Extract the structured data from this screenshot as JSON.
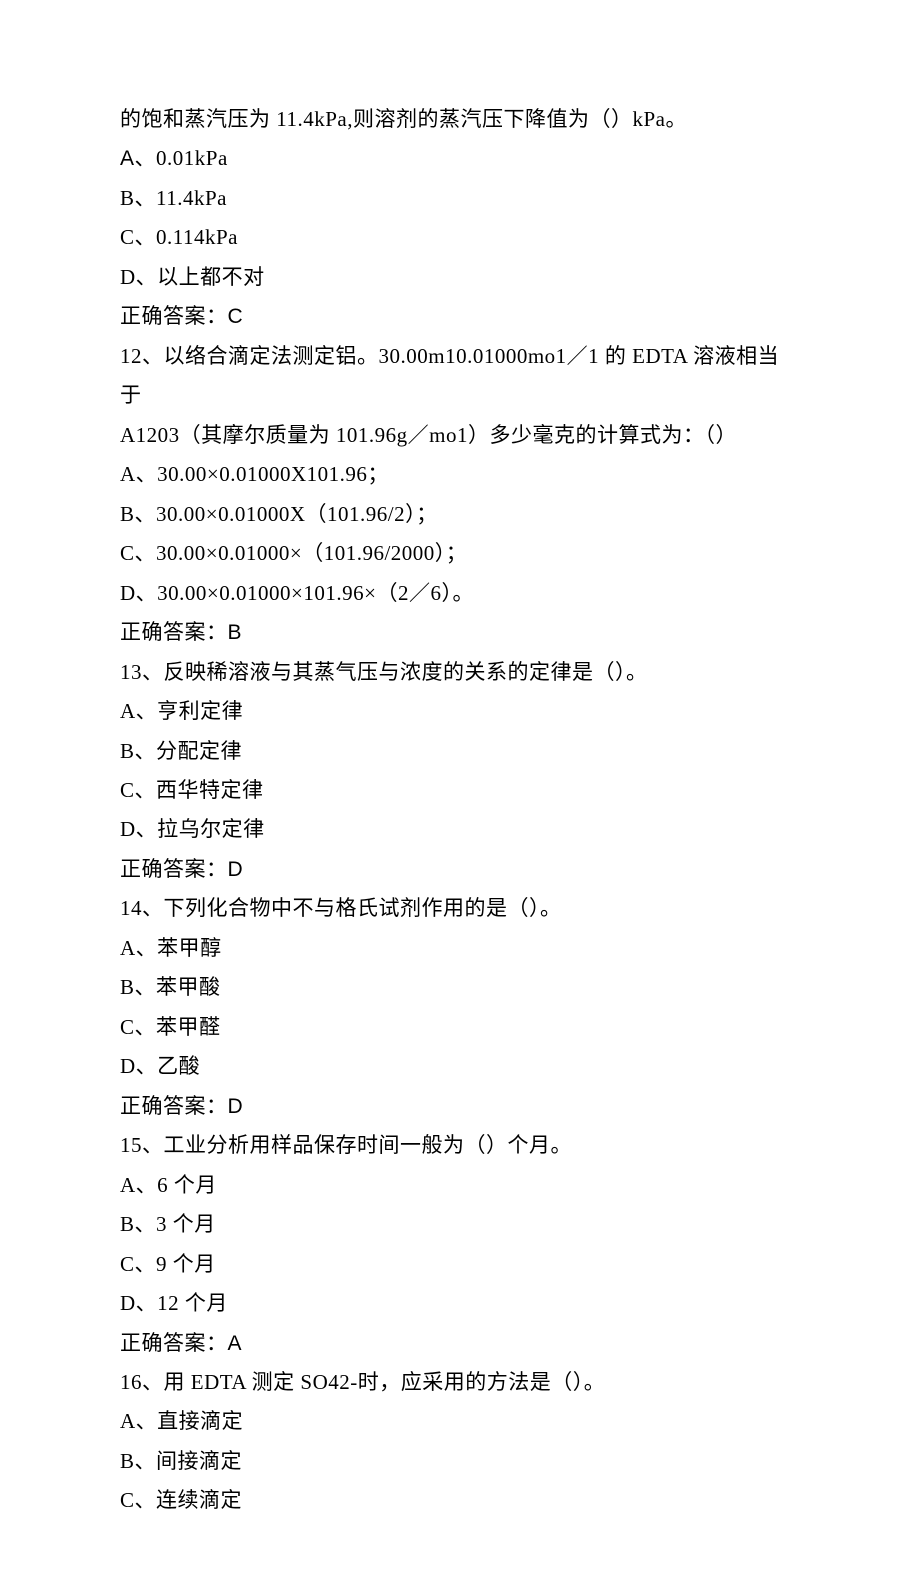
{
  "lines": [
    {
      "text": "的饱和蒸汽压为 11.4kPa,则溶剂的蒸汽压下降值为（）kPa。"
    },
    {
      "text": "A、0.01kPa",
      "prefixSans": true
    },
    {
      "text": "B、11.4kPa"
    },
    {
      "text": "C、0.114kPa"
    },
    {
      "text": "D、以上都不对"
    },
    {
      "text": "正确答案：C",
      "lastSans": true
    },
    {
      "text": "12、以络合滴定法测定铝。30.00m10.01000mo1／1 的 EDTA 溶液相当于"
    },
    {
      "text": "A1203（其摩尔质量为 101.96g／mo1）多少毫克的计算式为：（）"
    },
    {
      "text": "A、30.00×0.01000X101.96；"
    },
    {
      "text": "B、30.00×0.01000X（101.96/2）；"
    },
    {
      "text": "C、30.00×0.01000×（101.96/2000）；"
    },
    {
      "text": "D、30.00×0.01000×101.96×（2／6）。"
    },
    {
      "text": "正确答案：B",
      "lastSans": true
    },
    {
      "text": "13、反映稀溶液与其蒸气压与浓度的关系的定律是（）。"
    },
    {
      "text": "A、亨利定律"
    },
    {
      "text": "B、分配定律"
    },
    {
      "text": "C、西华特定律"
    },
    {
      "text": "D、拉乌尔定律"
    },
    {
      "text": "正确答案：D",
      "lastSans": true
    },
    {
      "text": "14、下列化合物中不与格氏试剂作用的是（）。"
    },
    {
      "text": "A、苯甲醇"
    },
    {
      "text": "B、苯甲酸"
    },
    {
      "text": "C、苯甲醛"
    },
    {
      "text": "D、乙酸"
    },
    {
      "text": "正确答案：D",
      "lastSans": true
    },
    {
      "text": "15、工业分析用样品保存时间一般为（）个月。"
    },
    {
      "text": "A、6 个月"
    },
    {
      "text": "B、3 个月"
    },
    {
      "text": "C、9 个月"
    },
    {
      "text": "D、12 个月"
    },
    {
      "text": "正确答案：A",
      "lastSans": true
    },
    {
      "text": "16、用 EDTA 测定 SO42-时，应采用的方法是（）。"
    },
    {
      "text": "A、直接滴定"
    },
    {
      "text": "B、间接滴定"
    },
    {
      "text": "C、连续滴定"
    }
  ]
}
